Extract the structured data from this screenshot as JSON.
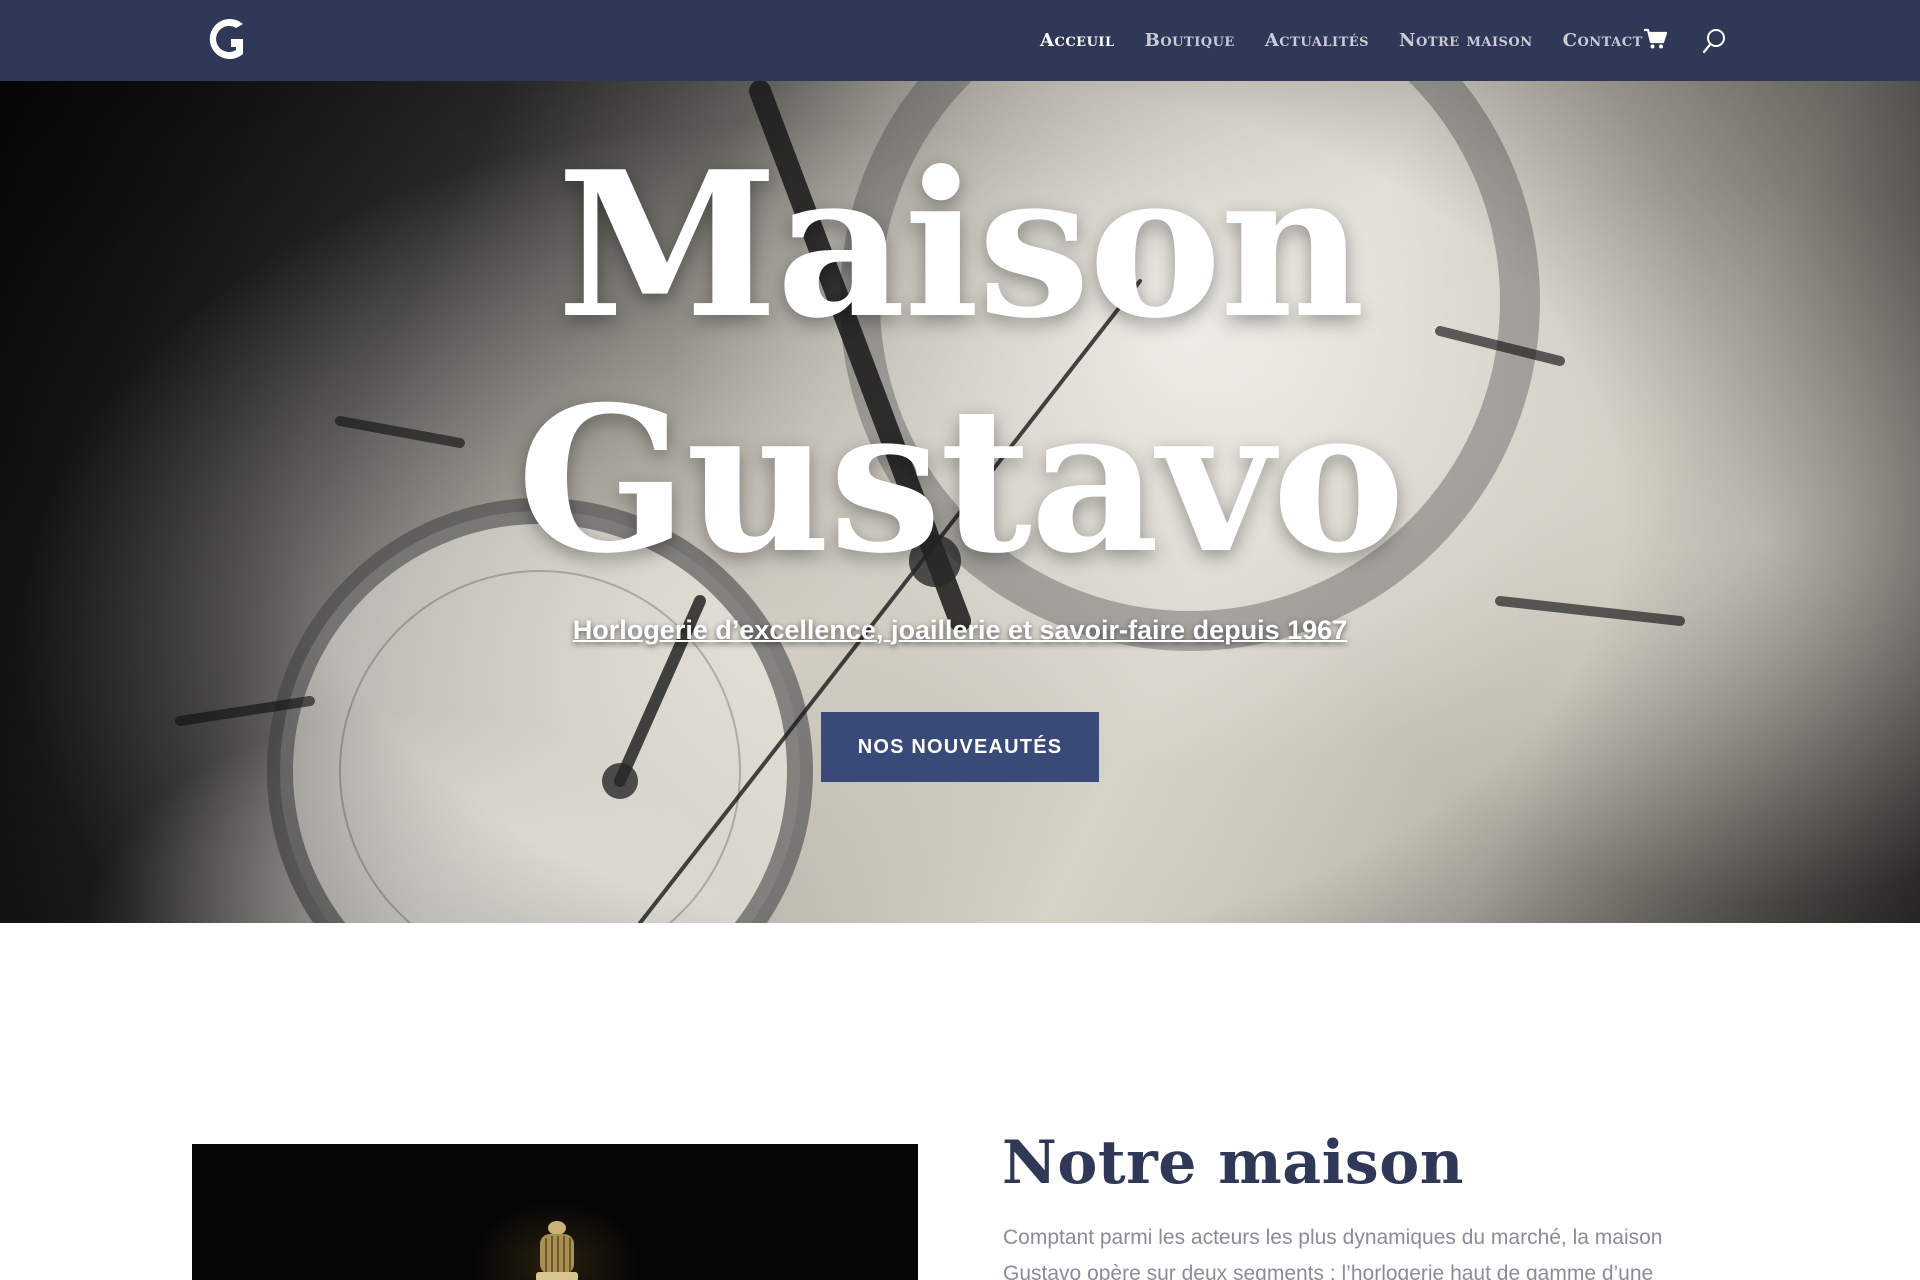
{
  "header": {
    "logo_icon": "gustavo-g-logo",
    "nav": [
      {
        "label": "Acceuil",
        "active": true
      },
      {
        "label": "Boutique",
        "active": false
      },
      {
        "label": "Actualités",
        "active": false
      },
      {
        "label": "Notre maison",
        "active": false
      },
      {
        "label": "Contact",
        "active": false
      }
    ],
    "cart_icon": "shopping-cart-icon",
    "search_icon": "search-icon"
  },
  "hero": {
    "title_line1": "Maison",
    "title_line2": "Gustavo",
    "tagline": "Horlogerie d’excellence, joaillerie et savoir-faire depuis 1967",
    "cta_label": "NOS NOUVEAUTÉS"
  },
  "about": {
    "title": "Notre maison",
    "text": "Comptant parmi les acteurs les plus dynamiques du marché, la maison Gustavo opère sur deux segments : l’horlogerie haut de gamme d’une"
  },
  "colors": {
    "header_bg": "#2f3856",
    "accent": "#3a4a78",
    "heading": "#2f3856",
    "body_text": "#8a8c99"
  }
}
